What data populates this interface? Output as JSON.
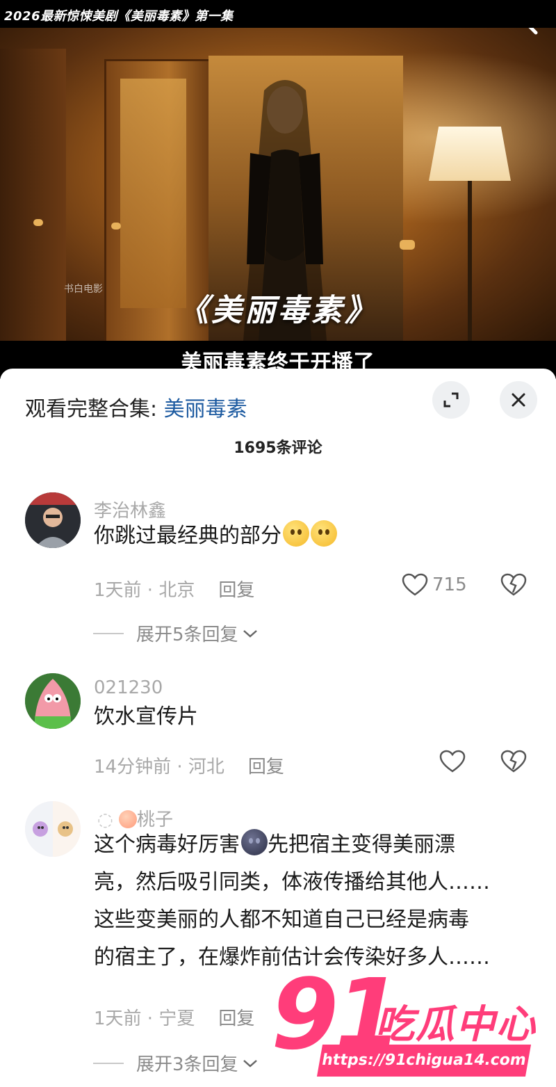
{
  "video": {
    "top_title": "2026最新惊悚美剧《美丽毒素》第一集",
    "watermark_text": "书白电影",
    "overlay_title": "《美丽毒素》",
    "subtitle": "美丽毒素终于开播了"
  },
  "panel": {
    "collection_prefix": "观看完整合集: ",
    "collection_link": "美丽毒素",
    "comment_count": "1695条评论"
  },
  "comments": [
    {
      "username": "李治林鑫",
      "text": "你跳过最经典的部分",
      "time_location": "1天前 · 北京",
      "reply_label": "回复",
      "likes": "715",
      "expand_label": "展开5条回复"
    },
    {
      "username": "021230",
      "text": "饮水宣传片",
      "time_location": "14分钟前 · 河北",
      "reply_label": "回复",
      "likes": ""
    },
    {
      "username": "桃子",
      "text_lines": [
        "这个病毒好厉害",
        "先把宿主变得美丽漂",
        "亮，然后吸引同类，体液传播给其他人……",
        "这些变美丽的人都不知道自己已经是病毒",
        "的宿主了，在爆炸前估计会传染好多人……"
      ],
      "time_location": "1天前 · 宁夏",
      "reply_label": "回复",
      "expand_label": "展开3条回复"
    }
  ],
  "site_watermark": {
    "number": "91",
    "name": "吃瓜中心",
    "url": "https://91chigua14.com"
  },
  "colors": {
    "link": "#1c5aa0",
    "meta_gray": "#a8a8a8",
    "watermark_pink": "#ff3d7a"
  },
  "icons": [
    "search-icon",
    "expand-icon",
    "close-icon",
    "heart-icon",
    "broken-heart-icon",
    "chevron-down-icon"
  ]
}
